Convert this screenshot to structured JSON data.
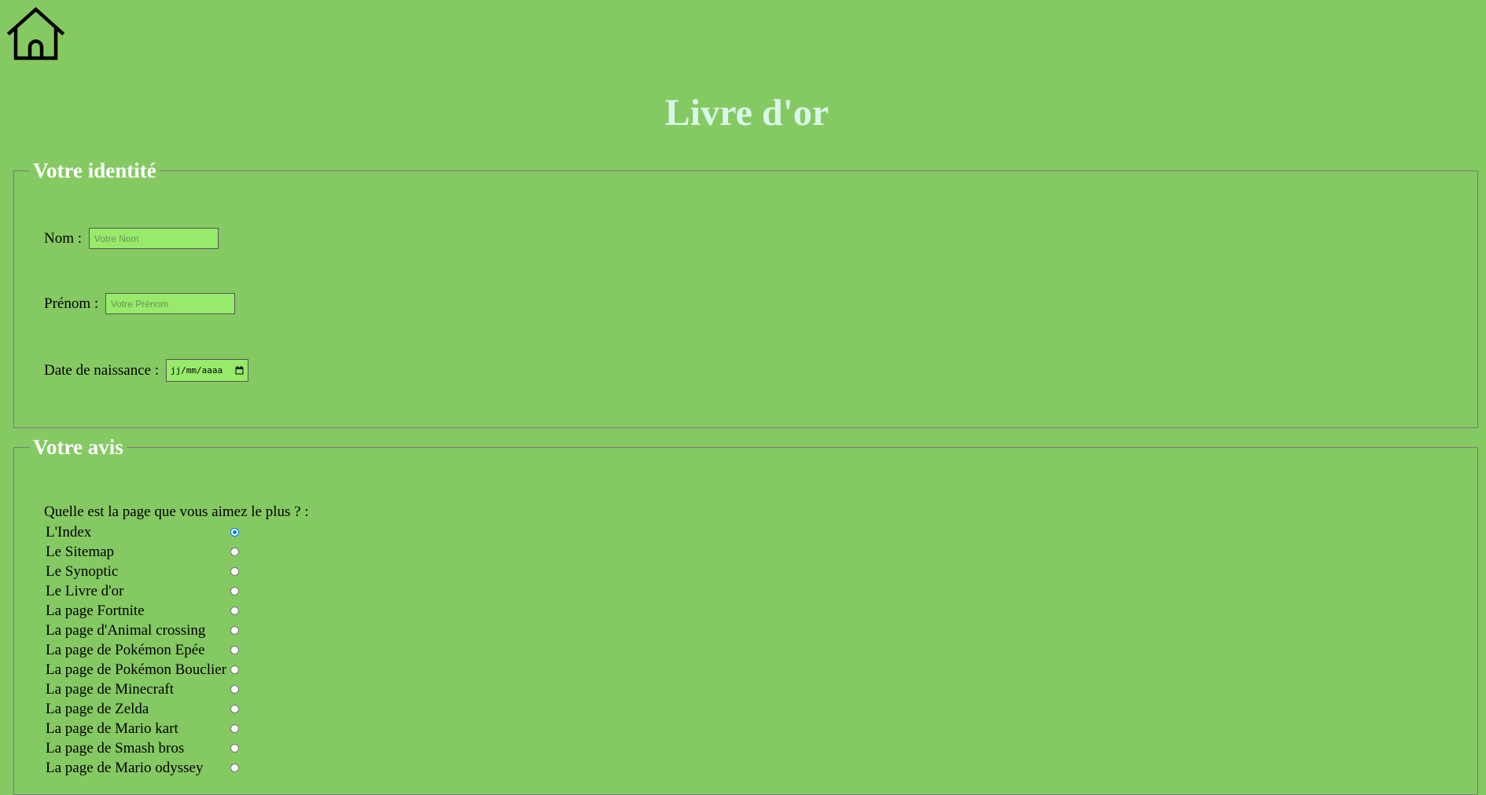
{
  "header": {
    "home_icon": "home-icon",
    "title": "Livre d'or"
  },
  "identity": {
    "legend": "Votre identité",
    "nom_label": "Nom : ",
    "nom_placeholder": "Votre Nom",
    "nom_value": "",
    "prenom_label": "Prénom : ",
    "prenom_placeholder": "Votre Prénom",
    "prenom_value": "",
    "dob_label": "Date de naissance : ",
    "dob_placeholder": "jj/mm/aaaa",
    "dob_icon": "calendar-icon"
  },
  "avis": {
    "legend": "Votre avis",
    "question": "Quelle est la page que vous aimez le plus ? :",
    "selected_index": 0,
    "options": [
      "L'Index",
      "Le Sitemap",
      "Le Synoptic",
      "Le Livre d'or",
      "La page Fortnite",
      "La page d'Animal crossing",
      "La page de Pokémon Epée",
      "La page de Pokémon Bouclier",
      "La page de Minecraft",
      "La page de Zelda",
      "La page de Mario kart",
      "La page de Smash bros",
      "La page de Mario odyssey"
    ]
  },
  "colors": {
    "background": "#85c963",
    "title": "#d9f7e9",
    "legend": "#ffffff",
    "input_bg": "#98ea6a",
    "radio_checked": "#0075ff"
  }
}
